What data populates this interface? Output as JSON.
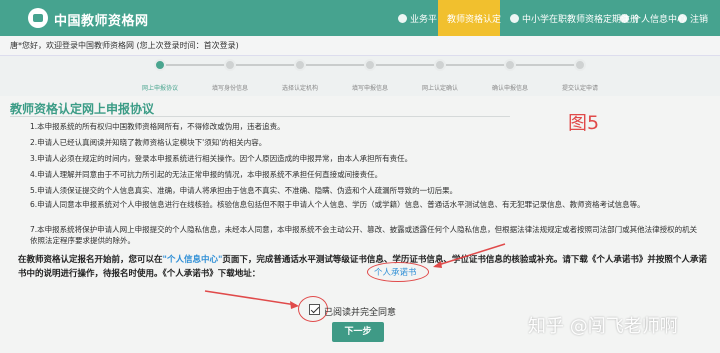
{
  "header": {
    "site_name": "中国教师资格网",
    "nav": [
      {
        "label": "业务平台",
        "icon": "home-icon"
      },
      {
        "label": "教师资格认定",
        "icon": "certificate-icon",
        "active": true
      },
      {
        "label": "中小学在职教师资格定期注册",
        "icon": "register-icon"
      },
      {
        "label": "个人信息中心",
        "icon": "user-icon"
      },
      {
        "label": "注销",
        "icon": "logout-icon"
      }
    ]
  },
  "welcome": "唐*您好，欢迎登录中国教师资格网 (您上次登录时间：首次登录)",
  "steps": [
    {
      "label": "网上申报协议",
      "active": true
    },
    {
      "label": "填写身份信息"
    },
    {
      "label": "选择认定机构"
    },
    {
      "label": "填写申报信息"
    },
    {
      "label": "网上认定确认"
    },
    {
      "label": "确认申报信息"
    },
    {
      "label": "提交认定申请"
    }
  ],
  "agreement": {
    "title": "教师资格认定网上申报协议",
    "figure_label": "图5",
    "items": [
      "1.本申报系统的所有权归中国教师资格网所有，不得修改或伪用，违者追责。",
      "2.申请人已经认真阅读并知晓了教师资格认定模块下'须知'的相关内容。",
      "3.申请人必须在规定的时间内，登录本申报系统进行相关操作。因个人原因造成的申报异常，由本人承担所有责任。",
      "4.申请人理解并同意由于不可抗力所引起的无法正常申报的情况，本申报系统不承担任何直接或间接责任。",
      "5.申请人须保证提交的个人信息真实、准确，申请人将承担由于信息不真实、不准确、隐瞒、伪造和个人疏漏所导致的一切后果。",
      "6.申请人同意本申报系统对个人申报信息进行在线核验。核验信息包括但不限于申请人个人信息、学历（或学籍）信息、普通话水平测试信息、有无犯罪记录信息、教师资格考试信息等。",
      "7.本申报系统将保护申请人网上申报提交的个人隐私信息，未经本人同意，本申报系统不会主动公开、篡改、披露或透露任何个人隐私信息，但根据法律法规规定或者按照司法部门或其他法律授权的机关依照法定程序要求提供的除外。"
    ],
    "notice_part1": "在教师资格认定报名开始前，您可以在",
    "notice_link": "\"个人信息中心\"",
    "notice_part2": "页面下，完成普通话水平测试等级证书信息、学历证书信息、学位证书信息的核验或补充。请下载《个人承诺书》并按照个人承诺书中的说明进行操作，待报名时使用。《个人承诺书》下载地址：",
    "download_link": "个人承诺书"
  },
  "agree": {
    "label": "已阅读并完全同意",
    "checked": true
  },
  "next_button": "下一步",
  "watermark": "知乎 @闯飞老师啊"
}
